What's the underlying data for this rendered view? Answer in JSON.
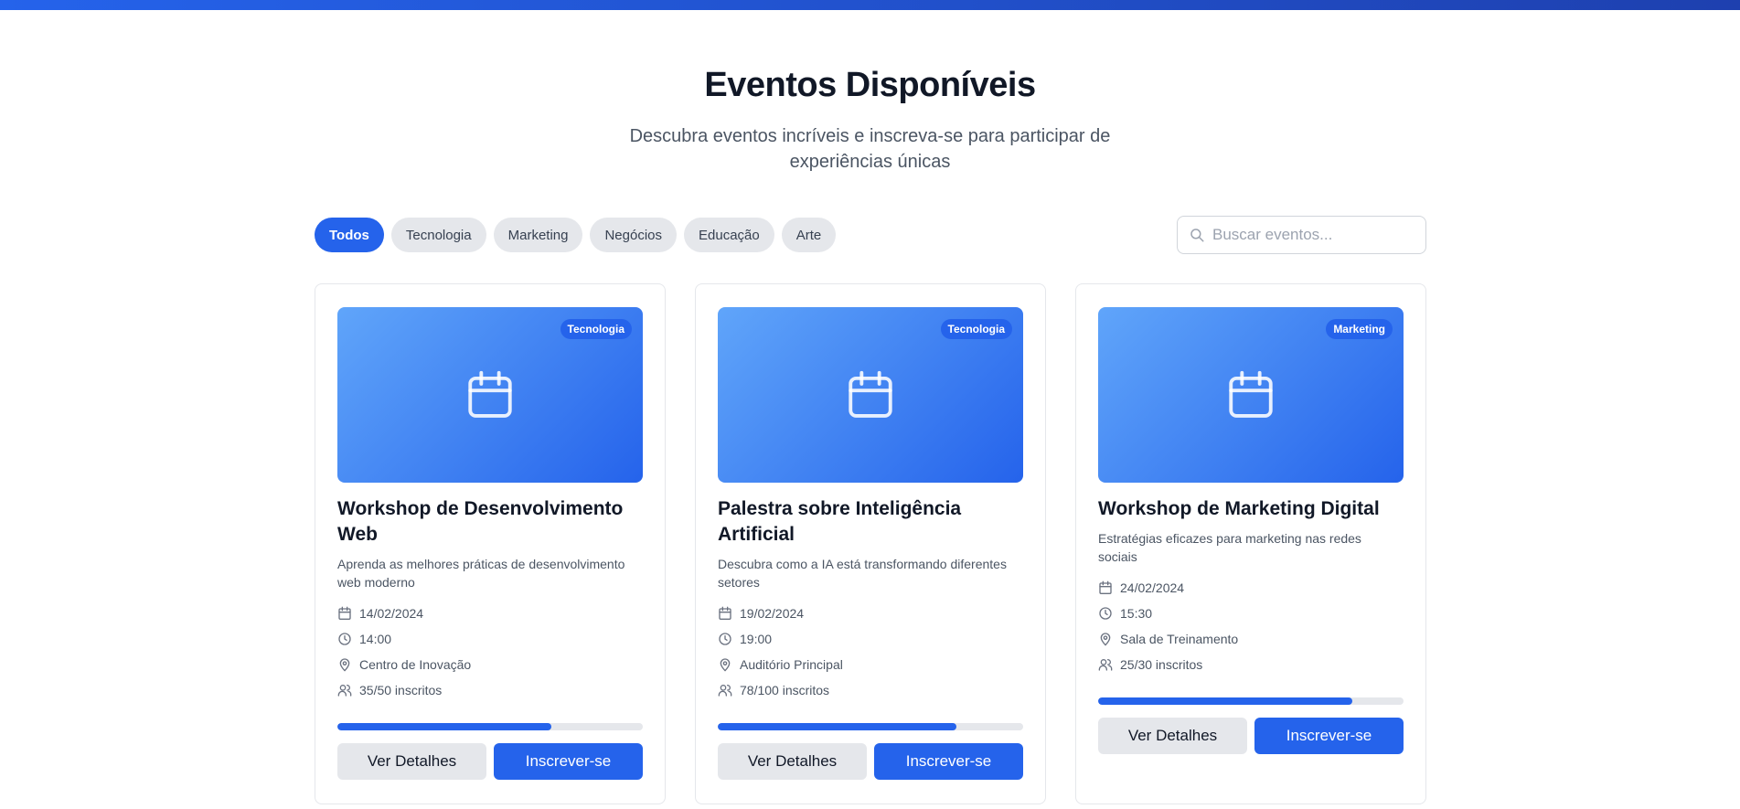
{
  "header": {
    "title": "Eventos Disponíveis",
    "subtitle": "Descubra eventos incríveis e inscreva-se para participar de experiências únicas"
  },
  "filters": [
    "Todos",
    "Tecnologia",
    "Marketing",
    "Negócios",
    "Educação",
    "Arte"
  ],
  "active_filter": "Todos",
  "search": {
    "placeholder": "Buscar eventos...",
    "icon": "search-icon"
  },
  "accent_color": "#2563eb",
  "events": [
    {
      "category": "Tecnologia",
      "title": "Workshop de Desenvolvimento Web",
      "description": "Aprenda as melhores práticas de desenvolvimento web moderno",
      "date": "14/02/2024",
      "time": "14:00",
      "location": "Centro de Inovação",
      "enrolled": "35/50 inscritos",
      "progress": 0.7,
      "details_label": "Ver Detalhes",
      "subscribe_label": "Inscrever-se"
    },
    {
      "category": "Tecnologia",
      "title": "Palestra sobre Inteligência Artificial",
      "description": "Descubra como a IA está transformando diferentes setores",
      "date": "19/02/2024",
      "time": "19:00",
      "location": "Auditório Principal",
      "enrolled": "78/100 inscritos",
      "progress": 0.78,
      "details_label": "Ver Detalhes",
      "subscribe_label": "Inscrever-se"
    },
    {
      "category": "Marketing",
      "title": "Workshop de Marketing Digital",
      "description": "Estratégias eficazes para marketing nas redes sociais",
      "date": "24/02/2024",
      "time": "15:30",
      "location": "Sala de Treinamento",
      "enrolled": "25/30 inscritos",
      "progress": 0.8333,
      "details_label": "Ver Detalhes",
      "subscribe_label": "Inscrever-se"
    }
  ]
}
